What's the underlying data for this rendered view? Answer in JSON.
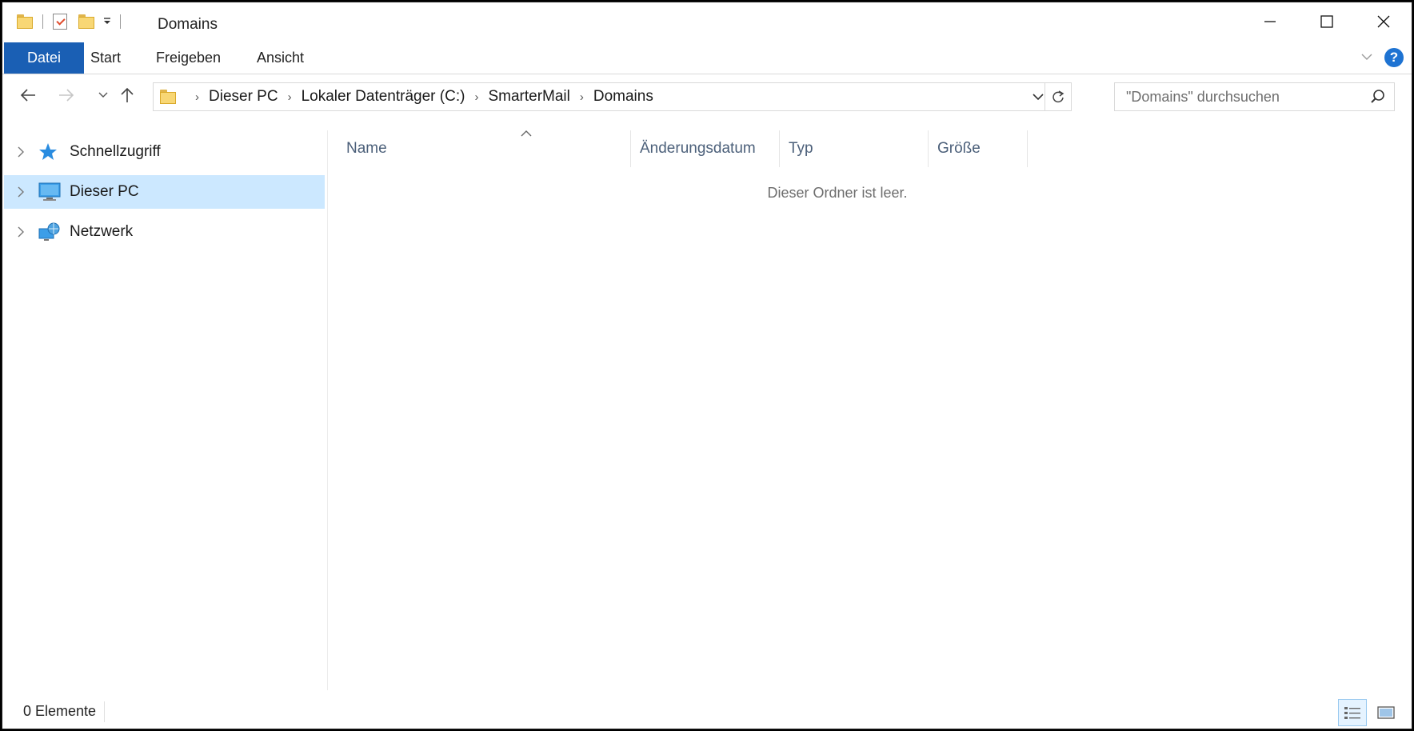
{
  "window": {
    "title": "Domains",
    "controls": {
      "minimize": "minimize",
      "maximize": "maximize",
      "close": "close"
    }
  },
  "ribbon": {
    "tabs": [
      "Datei",
      "Start",
      "Freigeben",
      "Ansicht"
    ],
    "active_tab": "Datei",
    "accent": "#1a5fb4"
  },
  "address": {
    "breadcrumbs": [
      "Dieser PC",
      "Lokaler Datenträger (C:)",
      "SmarterMail",
      "Domains"
    ]
  },
  "search": {
    "placeholder": "\"Domains\" durchsuchen"
  },
  "nav": {
    "items": [
      {
        "label": "Schnellzugriff",
        "icon": "star-icon",
        "selected": false
      },
      {
        "label": "Dieser PC",
        "icon": "computer-icon",
        "selected": true
      },
      {
        "label": "Netzwerk",
        "icon": "network-icon",
        "selected": false
      }
    ]
  },
  "content": {
    "columns": [
      "Name",
      "Änderungsdatum",
      "Typ",
      "Größe"
    ],
    "empty_message": "Dieser Ordner ist leer."
  },
  "status": {
    "item_count": "0 Elemente"
  }
}
